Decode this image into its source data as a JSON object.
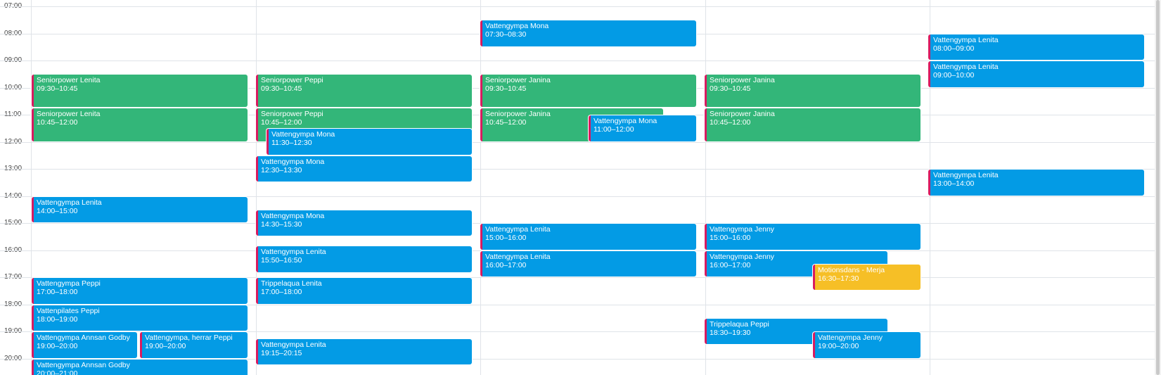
{
  "hours": [
    "07:00",
    "08:00",
    "09:00",
    "10:00",
    "11:00",
    "12:00",
    "13:00",
    "14:00",
    "15:00",
    "16:00",
    "17:00",
    "18:00",
    "19:00",
    "20:00"
  ],
  "colors": {
    "blue": "#039be5",
    "green": "#33b679",
    "yellow": "#f6bf26",
    "accent": "#d81b60",
    "grid": "#dfe3e8"
  },
  "events": [
    {
      "day": 0,
      "title": "Seniorpower Lenita",
      "time": "09:30–10:45",
      "start": "09:30",
      "end": "10:45",
      "color": "green"
    },
    {
      "day": 0,
      "title": "Seniorpower Lenita",
      "time": "10:45–12:00",
      "start": "10:45",
      "end": "12:00",
      "color": "green"
    },
    {
      "day": 0,
      "title": "Vattengympa Lenita",
      "time": "14:00–15:00",
      "start": "14:00",
      "end": "15:00",
      "color": "blue"
    },
    {
      "day": 0,
      "title": "Vattengympa Peppi",
      "time": "17:00–18:00",
      "start": "17:00",
      "end": "18:00",
      "color": "blue"
    },
    {
      "day": 0,
      "title": "Vattenpilates Peppi",
      "time": "18:00–19:00",
      "start": "18:00",
      "end": "19:00",
      "color": "blue"
    },
    {
      "day": 0,
      "title": "Vattengympa Annsan Godby",
      "time": "19:00–20:00",
      "start": "19:00",
      "end": "20:00",
      "color": "blue",
      "lane": "left"
    },
    {
      "day": 0,
      "title": "Vattengympa, herrar Peppi",
      "time": "19:00–20:00",
      "start": "19:00",
      "end": "20:00",
      "color": "blue",
      "lane": "right"
    },
    {
      "day": 0,
      "title": "Vattengympa Annsan Godby",
      "time": "20:00–21:00",
      "start": "20:00",
      "end": "21:00",
      "color": "blue"
    },
    {
      "day": 1,
      "title": "Seniorpower Peppi",
      "time": "09:30–10:45",
      "start": "09:30",
      "end": "10:45",
      "color": "green"
    },
    {
      "day": 1,
      "title": "Seniorpower Peppi",
      "time": "10:45–12:00",
      "start": "10:45",
      "end": "12:00",
      "color": "green"
    },
    {
      "day": 1,
      "title": "Vattengympa Mona",
      "time": "11:30–12:30",
      "start": "11:30",
      "end": "12:30",
      "color": "blue",
      "lane": "indent"
    },
    {
      "day": 1,
      "title": "Vattengympa Mona",
      "time": "12:30–13:30",
      "start": "12:30",
      "end": "13:30",
      "color": "blue"
    },
    {
      "day": 1,
      "title": "Vattengympa Mona",
      "time": "14:30–15:30",
      "start": "14:30",
      "end": "15:30",
      "color": "blue"
    },
    {
      "day": 1,
      "title": "Vattengympa Lenita",
      "time": "15:50–16:50",
      "start": "15:50",
      "end": "16:50",
      "color": "blue"
    },
    {
      "day": 1,
      "title": "Trippelaqua Lenita",
      "time": "17:00–18:00",
      "start": "17:00",
      "end": "18:00",
      "color": "blue"
    },
    {
      "day": 1,
      "title": "Vattengympa Lenita",
      "time": "19:15–20:15",
      "start": "19:15",
      "end": "20:15",
      "color": "blue"
    },
    {
      "day": 2,
      "title": "Vattengympa Mona",
      "time": "07:30–08:30",
      "start": "07:30",
      "end": "08:30",
      "color": "blue"
    },
    {
      "day": 2,
      "title": "Seniorpower Janina",
      "time": "09:30–10:45",
      "start": "09:30",
      "end": "10:45",
      "color": "green"
    },
    {
      "day": 2,
      "title": "Seniorpower Janina",
      "time": "10:45–12:00",
      "start": "10:45",
      "end": "12:00",
      "color": "green",
      "lane": "wide"
    },
    {
      "day": 2,
      "title": "Vattengympa Mona",
      "time": "11:00–12:00",
      "start": "11:00",
      "end": "12:00",
      "color": "blue",
      "lane": "right"
    },
    {
      "day": 2,
      "title": "Vattengympa Lenita",
      "time": "15:00–16:00",
      "start": "15:00",
      "end": "16:00",
      "color": "blue"
    },
    {
      "day": 2,
      "title": "Vattengympa Lenita",
      "time": "16:00–17:00",
      "start": "16:00",
      "end": "17:00",
      "color": "blue"
    },
    {
      "day": 3,
      "title": "Seniorpower Janina",
      "time": "09:30–10:45",
      "start": "09:30",
      "end": "10:45",
      "color": "green"
    },
    {
      "day": 3,
      "title": "Seniorpower Janina",
      "time": "10:45–12:00",
      "start": "10:45",
      "end": "12:00",
      "color": "green"
    },
    {
      "day": 3,
      "title": "Vattengympa Jenny",
      "time": "15:00–16:00",
      "start": "15:00",
      "end": "16:00",
      "color": "blue"
    },
    {
      "day": 3,
      "title": "Vattengympa Jenny",
      "time": "16:00–17:00",
      "start": "16:00",
      "end": "17:00",
      "color": "blue",
      "lane": "wide"
    },
    {
      "day": 3,
      "title": "Motionsdans - Merja",
      "time": "16:30–17:30",
      "start": "16:30",
      "end": "17:30",
      "color": "yellow",
      "lane": "right"
    },
    {
      "day": 3,
      "title": "Trippelaqua Peppi",
      "time": "18:30–19:30",
      "start": "18:30",
      "end": "19:30",
      "color": "blue",
      "lane": "wide"
    },
    {
      "day": 3,
      "title": "Vattengympa Jenny",
      "time": "19:00–20:00",
      "start": "19:00",
      "end": "20:00",
      "color": "blue",
      "lane": "right"
    },
    {
      "day": 4,
      "title": "Vattengympa Lenita",
      "time": "08:00–09:00",
      "start": "08:00",
      "end": "09:00",
      "color": "blue"
    },
    {
      "day": 4,
      "title": "Vattengympa Lenita",
      "time": "09:00–10:00",
      "start": "09:00",
      "end": "10:00",
      "color": "blue"
    },
    {
      "day": 4,
      "title": "Vattengympa Lenita",
      "time": "13:00–14:00",
      "start": "13:00",
      "end": "14:00",
      "color": "blue"
    }
  ]
}
